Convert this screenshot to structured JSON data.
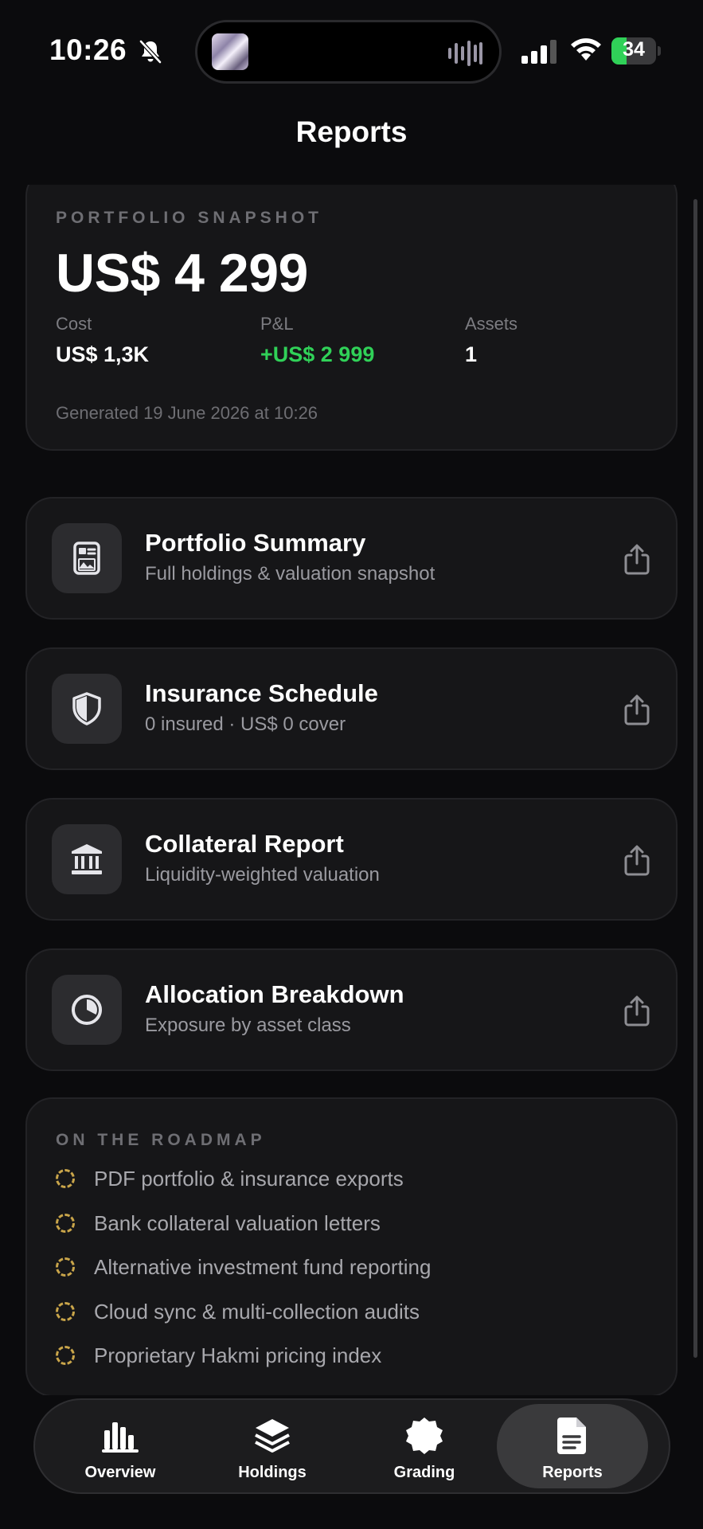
{
  "status_bar": {
    "time": "10:26",
    "battery": "34",
    "battery_fraction": 0.34,
    "battery_color": "#30d158"
  },
  "nav": {
    "title": "Reports"
  },
  "snapshot": {
    "label": "PORTFOLIO SNAPSHOT",
    "value": "US$ 4 299",
    "cost_label": "Cost",
    "cost_value": "US$ 1,3K",
    "pnl_label": "P&L",
    "pnl_value": "+US$ 2 999",
    "pnl_color": "#30d158",
    "assets_label": "Assets",
    "assets_value": "1",
    "generated": "Generated 19 June 2026 at 10:26"
  },
  "reports": [
    {
      "title": "Portfolio Summary",
      "subtitle": "Full holdings & valuation snapshot",
      "icon": "document-icon"
    },
    {
      "title": "Insurance Schedule",
      "subtitle": "0 insured · US$ 0 cover",
      "icon": "shield-icon"
    },
    {
      "title": "Collateral Report",
      "subtitle": "Liquidity-weighted valuation",
      "icon": "bank-icon"
    },
    {
      "title": "Allocation Breakdown",
      "subtitle": "Exposure by asset class",
      "icon": "pie-chart-icon"
    }
  ],
  "roadmap": {
    "label": "ON THE ROADMAP",
    "accent": "#c9a54a",
    "items": [
      "PDF portfolio & insurance exports",
      "Bank collateral valuation letters",
      "Alternative investment fund reporting",
      "Cloud sync & multi-collection audits",
      "Proprietary Hakmi pricing index"
    ]
  },
  "tabbar": {
    "tabs": [
      {
        "label": "Overview",
        "icon": "bar-chart-icon"
      },
      {
        "label": "Holdings",
        "icon": "layers-icon"
      },
      {
        "label": "Grading",
        "icon": "badge-icon"
      },
      {
        "label": "Reports",
        "icon": "document-icon"
      }
    ],
    "active": "Reports"
  }
}
